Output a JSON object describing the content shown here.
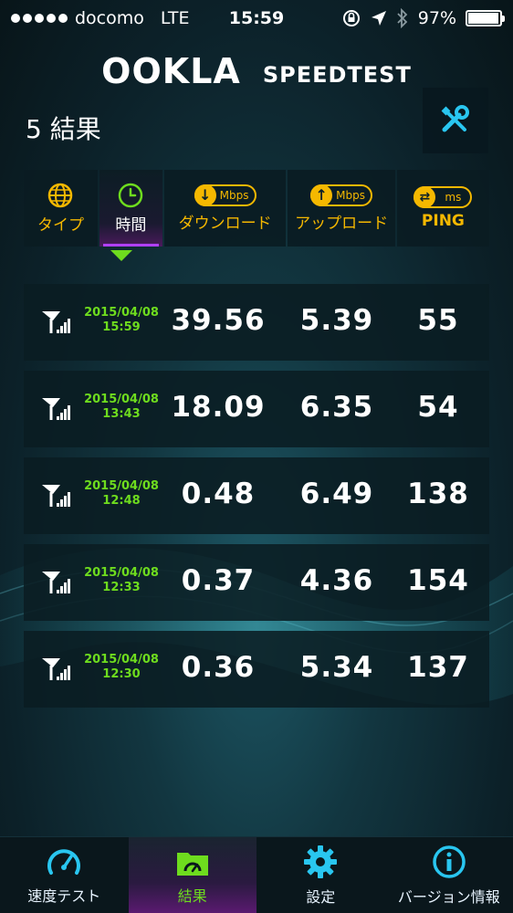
{
  "status_bar": {
    "carrier": "docomo",
    "network": "LTE",
    "time": "15:59",
    "battery": "97%",
    "battery_level": 0.97
  },
  "header": {
    "logo": "OOKLA",
    "subtitle": "SPEEDTEST"
  },
  "results": {
    "count_label": "5 結果"
  },
  "columns": [
    {
      "label": "タイプ"
    },
    {
      "label": "時間"
    },
    {
      "label": "ダウンロード",
      "unit": "Mbps"
    },
    {
      "label": "アップロード",
      "unit": "Mbps"
    },
    {
      "label": "PING",
      "unit": "ms"
    }
  ],
  "rows": [
    {
      "date": "2015/04/08",
      "time": "15:59",
      "download": "39.56",
      "upload": "5.39",
      "ping": "55"
    },
    {
      "date": "2015/04/08",
      "time": "13:43",
      "download": "18.09",
      "upload": "6.35",
      "ping": "54"
    },
    {
      "date": "2015/04/08",
      "time": "12:48",
      "download": "0.48",
      "upload": "6.49",
      "ping": "138"
    },
    {
      "date": "2015/04/08",
      "time": "12:33",
      "download": "0.37",
      "upload": "4.36",
      "ping": "154"
    },
    {
      "date": "2015/04/08",
      "time": "12:30",
      "download": "0.36",
      "upload": "5.34",
      "ping": "137"
    }
  ],
  "tabs": [
    {
      "label": "速度テスト"
    },
    {
      "label": "結果"
    },
    {
      "label": "設定"
    },
    {
      "label": "バージョン情報"
    }
  ],
  "colors": {
    "accent_yellow": "#f5b800",
    "accent_green": "#6edc1e",
    "accent_cyan": "#29c6f0",
    "active_purple": "#b040ff"
  }
}
